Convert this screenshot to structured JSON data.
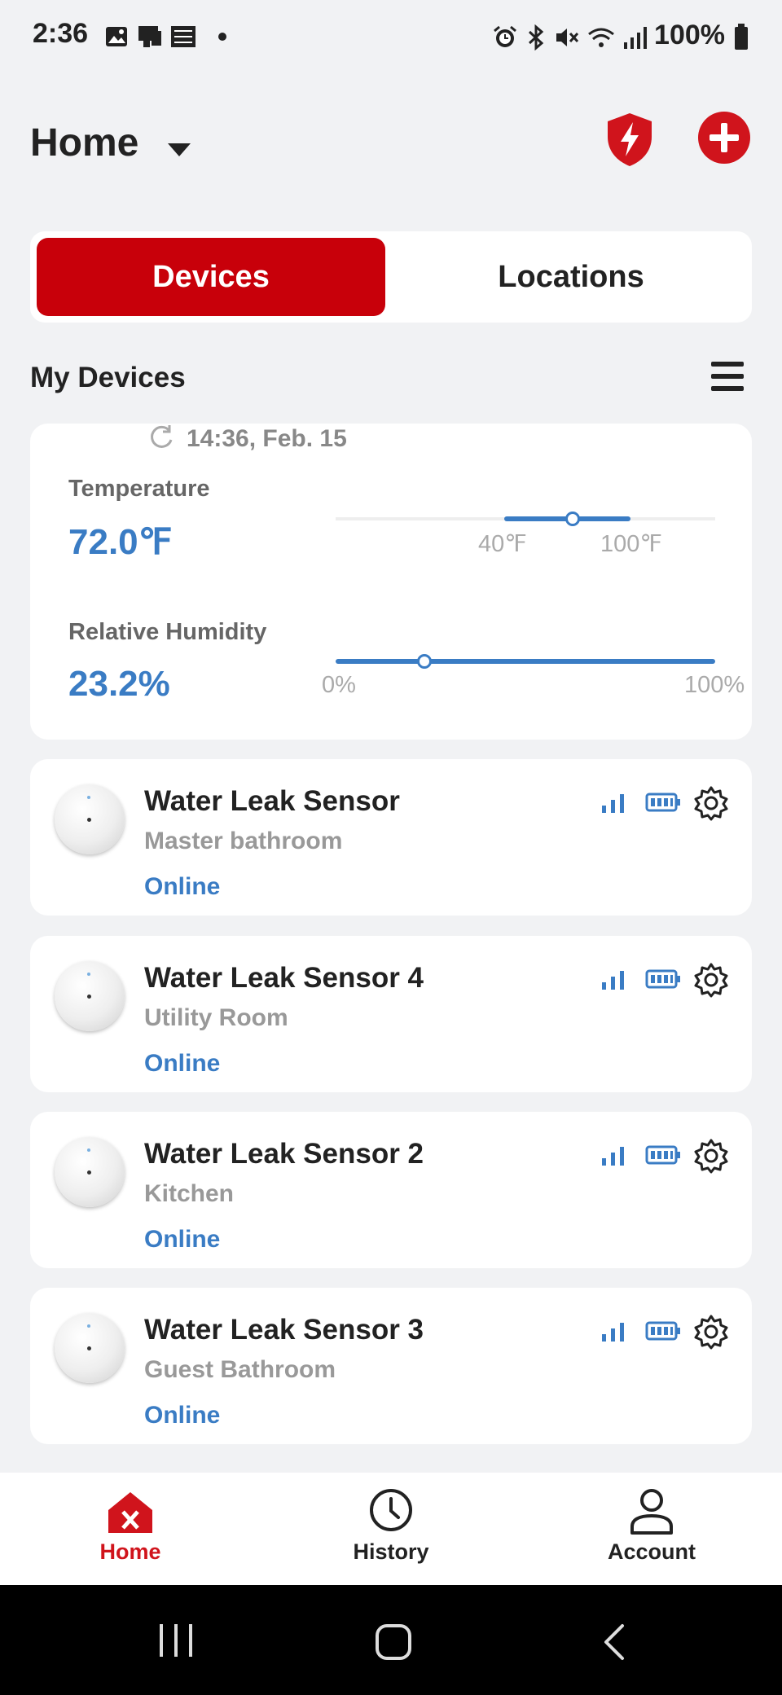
{
  "status_bar": {
    "time": "2:36",
    "battery": "100%"
  },
  "header": {
    "title": "Home"
  },
  "tabs": {
    "devices": "Devices",
    "locations": "Locations"
  },
  "section": {
    "title": "My Devices"
  },
  "climate": {
    "updated": "14:36, Feb. 15",
    "temperature": {
      "label": "Temperature",
      "value": "72.0℉",
      "min_label": "40℉",
      "max_label": "100℉",
      "level": 0.5
    },
    "humidity": {
      "label": "Relative Humidity",
      "value": "23.2%",
      "min_label": "0%",
      "max_label": "100%",
      "level": 0.232
    }
  },
  "devices": [
    {
      "name": "Water Leak Sensor",
      "location": "Master bathroom",
      "status": "Online"
    },
    {
      "name": "Water Leak Sensor 4",
      "location": "Utility Room",
      "status": "Online"
    },
    {
      "name": "Water Leak Sensor 2",
      "location": "Kitchen",
      "status": "Online"
    },
    {
      "name": "Water Leak Sensor 3",
      "location": "Guest Bathroom",
      "status": "Online"
    }
  ],
  "bottom_nav": {
    "home": "Home",
    "history": "History",
    "account": "Account"
  },
  "colors": {
    "accent_red": "#c8000a",
    "accent_blue": "#3a7cc4",
    "background": "#f1f2f4"
  },
  "icons": [
    "gallery-icon",
    "alarm-icon",
    "bluetooth-icon",
    "mute-icon",
    "wifi-icon",
    "signal-icon",
    "battery-icon",
    "shield-bolt-icon",
    "add-icon",
    "menu-icon",
    "refresh-icon",
    "gear-icon",
    "home-icon",
    "clock-icon",
    "person-icon"
  ]
}
